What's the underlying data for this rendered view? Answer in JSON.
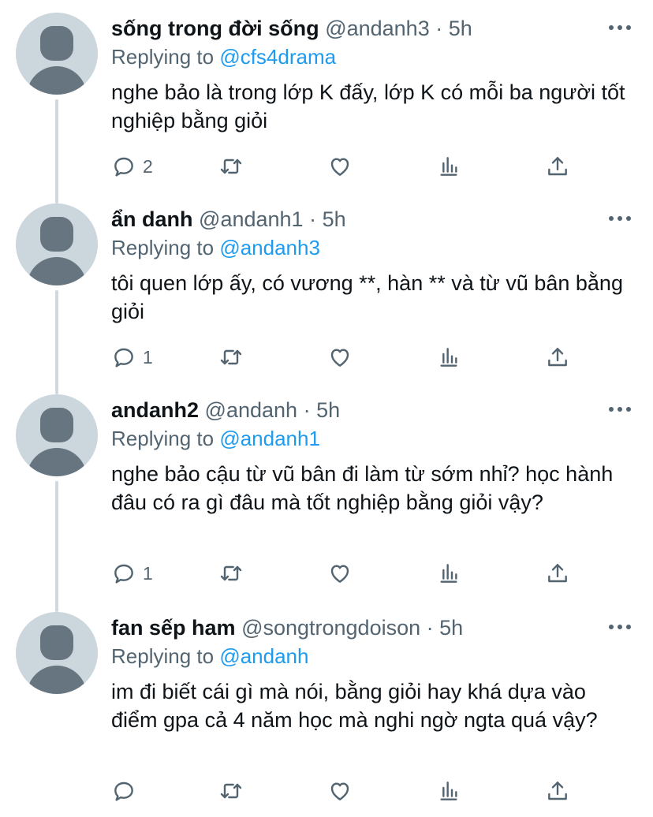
{
  "tweets": [
    {
      "name": "sống trong đời sống",
      "handle": "@andanh3",
      "dot": "·",
      "time": "5h",
      "replying_prefix": "Replying to",
      "replying_to": "@cfs4drama",
      "text": "nghe bảo là trong lớp K đấy, lớp K có mỗi ba người tốt nghiệp bằng giỏi",
      "reply_count": "2"
    },
    {
      "name": "ẩn danh",
      "handle": "@andanh1",
      "dot": "·",
      "time": "5h",
      "replying_prefix": "Replying to",
      "replying_to": "@andanh3",
      "text": "tôi quen lớp ấy, có vương **, hàn ** và từ vũ bân bằng giỏi",
      "reply_count": "1"
    },
    {
      "name": "andanh2",
      "handle": "@andanh",
      "dot": "·",
      "time": "5h",
      "replying_prefix": "Replying to",
      "replying_to": "@andanh1",
      "text": "nghe bảo cậu từ vũ bân đi làm từ sớm nhỉ? học hành đâu có ra gì đâu mà tốt nghiệp bằng giỏi vậy?",
      "reply_count": "1"
    },
    {
      "name": "fan sếp ham",
      "handle": "@songtrongdoison",
      "dot": "·",
      "time": "5h",
      "replying_prefix": "Replying to",
      "replying_to": "@andanh",
      "text": "im đi biết cái gì mà nói, bằng giỏi hay khá dựa vào điểm gpa cả 4 năm học mà nghi ngờ ngta quá vậy?",
      "reply_count": ""
    }
  ],
  "icons": {
    "reply": "reply-icon",
    "retweet": "retweet-icon",
    "like": "like-icon",
    "views": "views-icon",
    "share": "share-icon",
    "more": "more-icon"
  },
  "colors": {
    "link": "#1d9bf0",
    "secondary_text": "#536471",
    "avatar_bg": "#ccd6dd",
    "avatar_fg": "#66757f",
    "thread_line": "#cfd9de"
  }
}
